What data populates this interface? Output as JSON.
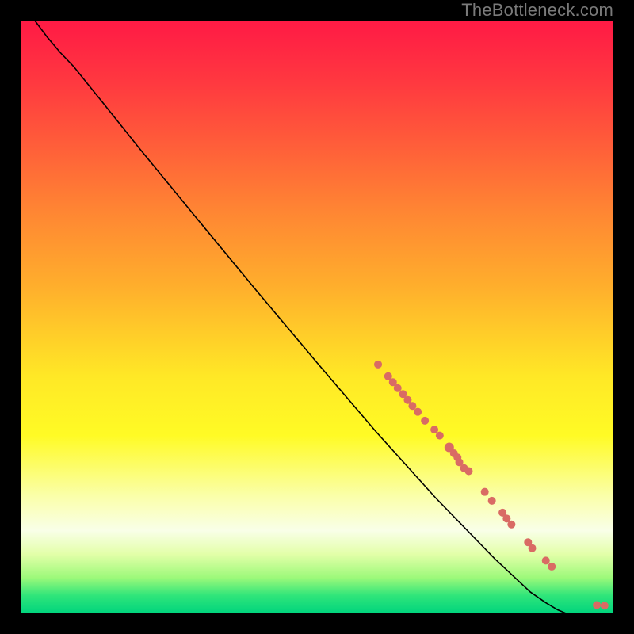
{
  "attribution": "TheBottleneck.com",
  "colors": {
    "marker": "#d96b64",
    "line": "#000000"
  },
  "chart_data": {
    "type": "line",
    "title": "",
    "xlabel": "",
    "ylabel": "",
    "xlim": [
      0,
      100
    ],
    "ylim": [
      0,
      100
    ],
    "grid": false,
    "curve": [
      {
        "x": 2.4,
        "y": 100
      },
      {
        "x": 4.5,
        "y": 97.2
      },
      {
        "x": 6.7,
        "y": 94.6
      },
      {
        "x": 9.0,
        "y": 92.2
      },
      {
        "x": 11.0,
        "y": 89.7
      },
      {
        "x": 14.0,
        "y": 86.0
      },
      {
        "x": 20.0,
        "y": 78.5
      },
      {
        "x": 30.0,
        "y": 66.3
      },
      {
        "x": 40.0,
        "y": 54.2
      },
      {
        "x": 50.0,
        "y": 42.3
      },
      {
        "x": 60.0,
        "y": 30.6
      },
      {
        "x": 70.0,
        "y": 19.5
      },
      {
        "x": 80.0,
        "y": 9.2
      },
      {
        "x": 86.0,
        "y": 3.6
      },
      {
        "x": 88.6,
        "y": 1.8
      },
      {
        "x": 90.6,
        "y": 0.6
      },
      {
        "x": 92.0,
        "y": 0.0
      },
      {
        "x": 95.0,
        "y": 0.0
      },
      {
        "x": 100.0,
        "y": 0.0
      }
    ],
    "markers": [
      {
        "x": 60.3,
        "y": 42.0,
        "r": 5
      },
      {
        "x": 62.0,
        "y": 40.0,
        "r": 5
      },
      {
        "x": 62.8,
        "y": 39.0,
        "r": 5
      },
      {
        "x": 63.6,
        "y": 38.0,
        "r": 5
      },
      {
        "x": 64.5,
        "y": 37.0,
        "r": 5
      },
      {
        "x": 65.3,
        "y": 36.0,
        "r": 5
      },
      {
        "x": 66.1,
        "y": 35.0,
        "r": 5
      },
      {
        "x": 67.0,
        "y": 34.0,
        "r": 5
      },
      {
        "x": 68.2,
        "y": 32.5,
        "r": 5
      },
      {
        "x": 69.8,
        "y": 31.0,
        "r": 5
      },
      {
        "x": 70.7,
        "y": 30.0,
        "r": 5
      },
      {
        "x": 72.3,
        "y": 28.0,
        "r": 6
      },
      {
        "x": 73.1,
        "y": 27.0,
        "r": 5
      },
      {
        "x": 73.7,
        "y": 26.3,
        "r": 5
      },
      {
        "x": 74.0,
        "y": 25.5,
        "r": 5
      },
      {
        "x": 74.8,
        "y": 24.5,
        "r": 5
      },
      {
        "x": 75.6,
        "y": 24.0,
        "r": 5
      },
      {
        "x": 78.3,
        "y": 20.5,
        "r": 5
      },
      {
        "x": 79.5,
        "y": 19.0,
        "r": 5
      },
      {
        "x": 81.3,
        "y": 17.0,
        "r": 5
      },
      {
        "x": 82.0,
        "y": 16.0,
        "r": 5
      },
      {
        "x": 82.8,
        "y": 15.0,
        "r": 5
      },
      {
        "x": 85.6,
        "y": 12.0,
        "r": 5
      },
      {
        "x": 86.3,
        "y": 11.0,
        "r": 5
      },
      {
        "x": 88.6,
        "y": 8.9,
        "r": 5
      },
      {
        "x": 89.6,
        "y": 7.9,
        "r": 5
      },
      {
        "x": 97.2,
        "y": 1.4,
        "r": 5
      },
      {
        "x": 98.5,
        "y": 1.3,
        "r": 5
      }
    ]
  }
}
